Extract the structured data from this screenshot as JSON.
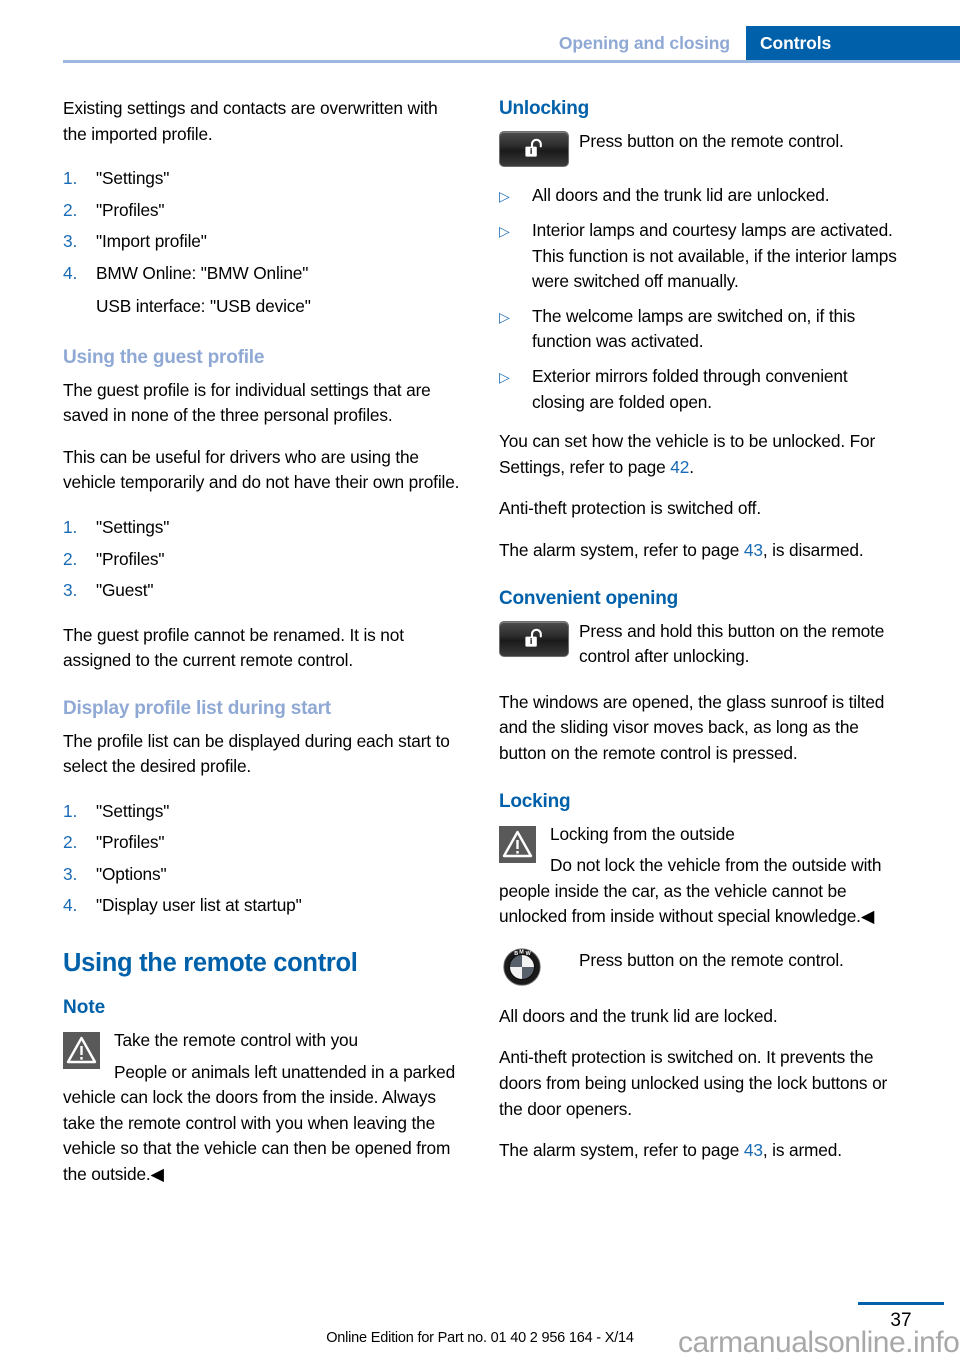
{
  "header": {
    "breadcrumb_secondary": "Opening and closing",
    "breadcrumb_primary": "Controls"
  },
  "left_column": {
    "intro_paragraph": "Existing settings and contacts are overwritten with the imported profile.",
    "import_steps": [
      {
        "num": "1.",
        "text": "\"Settings\""
      },
      {
        "num": "2.",
        "text": "\"Profiles\""
      },
      {
        "num": "3.",
        "text": "\"Import profile\""
      },
      {
        "num": "4.",
        "text": "BMW Online: \"BMW Online\""
      }
    ],
    "import_steps_subline": "USB interface: \"USB device\"",
    "guest_heading": "Using the guest profile",
    "guest_para_1": "The guest profile is for individual settings that are saved in none of the three personal profiles.",
    "guest_para_2": "This can be useful for drivers who are using the vehicle temporarily and do not have their own profile.",
    "guest_steps": [
      {
        "num": "1.",
        "text": "\"Settings\""
      },
      {
        "num": "2.",
        "text": "\"Profiles\""
      },
      {
        "num": "3.",
        "text": "\"Guest\""
      }
    ],
    "guest_para_3": "The guest profile cannot be renamed. It is not assigned to the current remote control.",
    "display_heading": "Display profile list during start",
    "display_para": "The profile list can be displayed during each start to select the desired profile.",
    "display_steps": [
      {
        "num": "1.",
        "text": "\"Settings\""
      },
      {
        "num": "2.",
        "text": "\"Profiles\""
      },
      {
        "num": "3.",
        "text": "\"Options\""
      },
      {
        "num": "4.",
        "text": "\"Display user list at startup\""
      }
    ],
    "chapter_heading": "Using the remote control",
    "note_heading": "Note",
    "note_title": "Take the remote control with you",
    "note_body": "People or animals left unattended in a parked vehicle can lock the doors from the inside. Always take the remote control with you when leaving the vehicle so that the vehicle can then be opened from the outside.◀"
  },
  "right_column": {
    "unlocking_heading": "Unlocking",
    "unlocking_icon_text": "Press button on the remote control.",
    "unlocking_bullets": [
      "All doors and the trunk lid are unlocked.",
      "Interior lamps and courtesy lamps are activated. This function is not available, if the interior lamps were switched off manually.",
      "The welcome lamps are switched on, if this function was activated.",
      "Exterior mirrors folded through convenient closing are folded open."
    ],
    "settings_para_prefix": "You can set how the vehicle is to be unlocked. For Settings, refer to page ",
    "settings_para_pageref": "42",
    "settings_para_suffix": ".",
    "antitheft_off_para": "Anti-theft protection is switched off.",
    "alarm_disarmed_prefix": "The alarm system, refer to page ",
    "alarm_disarmed_pageref": "43",
    "alarm_disarmed_suffix": ", is disarmed.",
    "convenient_heading": "Convenient opening",
    "convenient_icon_text": "Press and hold this button on the remote control after unlocking.",
    "convenient_para": "The windows are opened, the glass sunroof is tilted and the sliding visor moves back, as long as the button on the remote control is pressed.",
    "locking_heading": "Locking",
    "locking_warn_title": "Locking from the outside",
    "locking_warn_body": "Do not lock the vehicle from the outside with people inside the car, as the vehicle cannot be unlocked from inside without special knowledge.◀",
    "locking_icon_text": "Press button on the remote control.",
    "locked_para": "All doors and the trunk lid are locked.",
    "antitheft_on_para": "Anti-theft protection is switched on. It prevents the doors from being unlocked using the lock buttons or the door openers.",
    "alarm_armed_prefix": "The alarm system, refer to page ",
    "alarm_armed_pageref": "43",
    "alarm_armed_suffix": ", is armed."
  },
  "footer": {
    "page_number": "37",
    "edition_text": "Online Edition for Part no. 01 40 2 956 164 - X/14",
    "watermark": "carmanualsonline.info"
  },
  "icons": {
    "warning": "warning-triangle-icon",
    "remote_unlock": "remote-unlock-button-icon",
    "bmw_roundel": "bmw-roundel-icon",
    "bullet": "triangle-bullet-icon"
  },
  "colors": {
    "brand_blue": "#0060a9",
    "muted_blue": "#8fa9d4",
    "link_blue": "#1a6bb5"
  }
}
